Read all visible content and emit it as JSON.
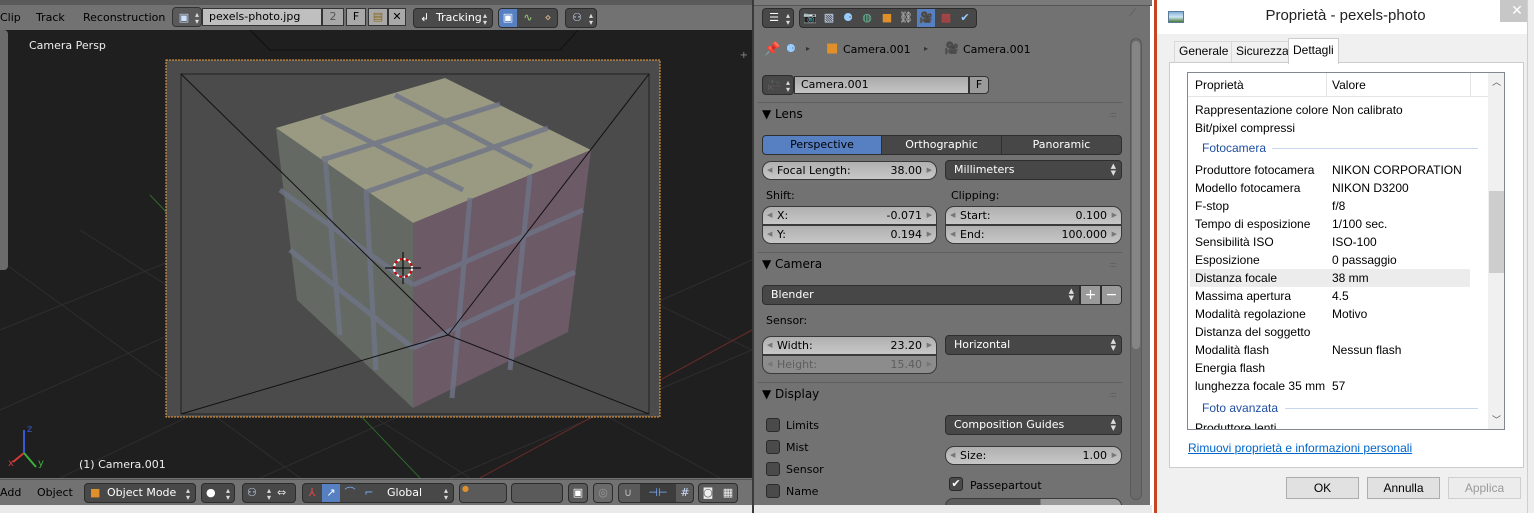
{
  "blender": {
    "header_menu": [
      "Clip",
      "Track",
      "Reconstruction"
    ],
    "clip_name": "pexels-photo.jpg",
    "clip_users": "2",
    "fake_user_label": "F",
    "mode_select": "Tracking",
    "viewport": {
      "view_label": "Camera Persp",
      "object_caption": "(1) Camera.001",
      "axis_labels": {
        "x": "x",
        "y": "y",
        "z": "z"
      }
    },
    "footer_menu": [
      "Add",
      "Object"
    ],
    "object_mode": "Object Mode",
    "transform_orientation": "Global"
  },
  "properties": {
    "breadcrumb": [
      "Camera.001",
      "Camera.001"
    ],
    "datablock_name": "Camera.001",
    "datablock_fake": "F",
    "lens": {
      "header": "Lens",
      "types": [
        "Perspective",
        "Orthographic",
        "Panoramic"
      ],
      "active_type": "Perspective",
      "focal_length_label": "Focal Length:",
      "focal_length": "38.00",
      "lens_unit": "Millimeters",
      "shift_label": "Shift:",
      "shift_x_label": "X:",
      "shift_x": "-0.071",
      "shift_y_label": "Y:",
      "shift_y": "0.194",
      "clipping_label": "Clipping:",
      "clip_start_label": "Start:",
      "clip_start": "0.100",
      "clip_end_label": "End:",
      "clip_end": "100.000"
    },
    "camera": {
      "header": "Camera",
      "preset": "Blender",
      "sensor_label": "Sensor:",
      "width_label": "Width:",
      "width": "23.20",
      "height_label": "Height:",
      "height": "15.40",
      "sensor_fit": "Horizontal"
    },
    "display": {
      "header": "Display",
      "checkboxes": [
        {
          "label": "Limits",
          "checked": false
        },
        {
          "label": "Mist",
          "checked": false
        },
        {
          "label": "Sensor",
          "checked": false
        },
        {
          "label": "Name",
          "checked": false
        }
      ],
      "composition_guides": "Composition Guides",
      "size_label": "Size:",
      "size": "1.00",
      "passepartout_label": "Passepartout",
      "passepartout_checked": true
    }
  },
  "dialog": {
    "title": "Proprietà - pexels-photo",
    "close_label": "✕",
    "tabs": [
      "Generale",
      "Sicurezza",
      "Dettagli"
    ],
    "active_tab": "Dettagli",
    "columns": [
      "Proprietà",
      "Valore"
    ],
    "rows_before": [
      {
        "key": "Rappresentazione colore",
        "value": "Non calibrato"
      },
      {
        "key": "Bit/pixel compressi",
        "value": ""
      }
    ],
    "group1": "Fotocamera",
    "rows_camera": [
      {
        "key": "Produttore fotocamera",
        "value": "NIKON CORPORATION"
      },
      {
        "key": "Modello fotocamera",
        "value": "NIKON D3200"
      },
      {
        "key": "F-stop",
        "value": "f/8"
      },
      {
        "key": "Tempo di esposizione",
        "value": "1/100 sec."
      },
      {
        "key": "Sensibilità ISO",
        "value": "ISO-100"
      },
      {
        "key": "Esposizione",
        "value": "0 passaggio"
      },
      {
        "key": "Distanza focale",
        "value": "38 mm"
      },
      {
        "key": "Massima apertura",
        "value": "4.5"
      },
      {
        "key": "Modalità regolazione",
        "value": "Motivo"
      },
      {
        "key": "Distanza del soggetto",
        "value": ""
      },
      {
        "key": "Modalità flash",
        "value": "Nessun flash"
      },
      {
        "key": "Energia flash",
        "value": ""
      },
      {
        "key": "lunghezza focale 35 mm",
        "value": "57"
      }
    ],
    "selected_row": "Distanza focale",
    "group2": "Foto avanzata",
    "row_partial": "Produttore lenti",
    "link": "Rimuovi proprietà e informazioni personali",
    "buttons": {
      "ok": "OK",
      "cancel": "Annulla",
      "apply": "Applica"
    }
  }
}
